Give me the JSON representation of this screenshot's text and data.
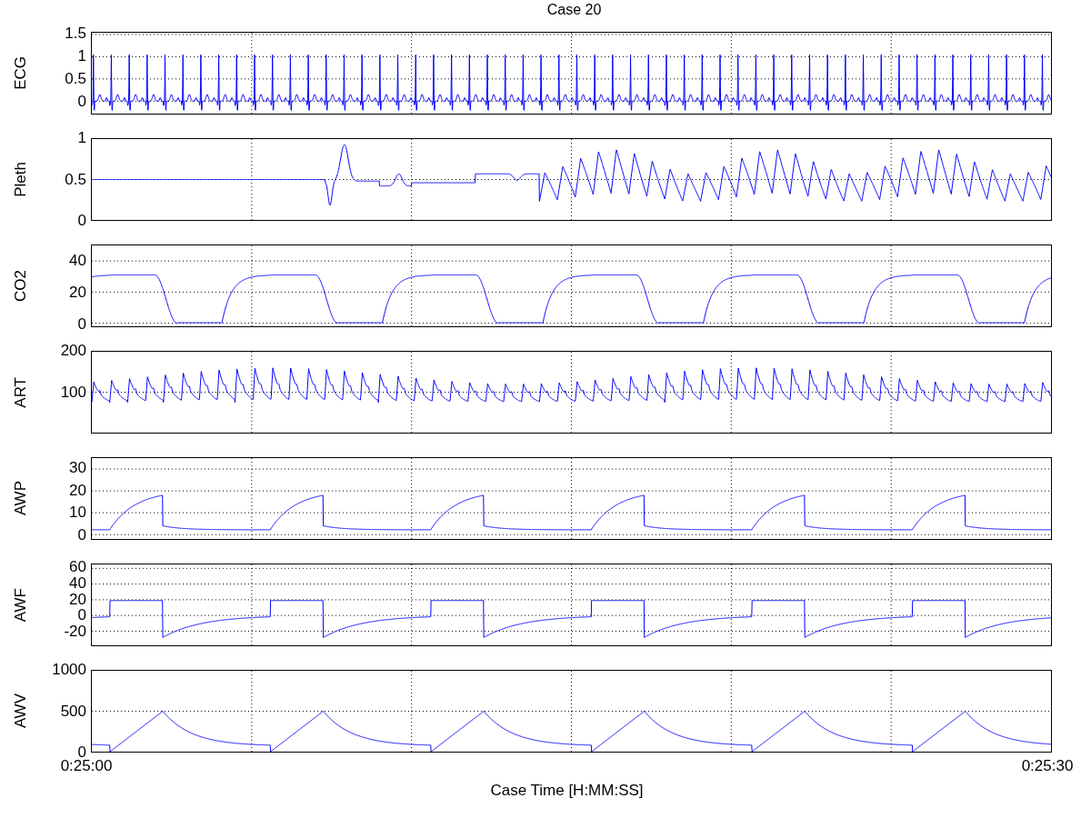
{
  "figure": {
    "title": "Case 20"
  },
  "panels": [
    {
      "kind": "ecg",
      "ylabel": "ECG",
      "yticks": [
        "1.5",
        "1",
        "0.5",
        "0"
      ]
    },
    {
      "kind": "pleth",
      "ylabel": "Pleth",
      "yticks": [
        "1",
        "0.5",
        "0"
      ]
    },
    {
      "kind": "co2",
      "ylabel": "CO2",
      "yticks": [
        "40",
        "20",
        "0"
      ]
    },
    {
      "kind": "art",
      "ylabel": "ART",
      "yticks": [
        "200",
        "100"
      ]
    },
    {
      "kind": "awp",
      "ylabel": "AWP",
      "yticks": [
        "30",
        "20",
        "10",
        "0"
      ]
    },
    {
      "kind": "awf",
      "ylabel": "AWF",
      "yticks": [
        "60",
        "40",
        "20",
        "0",
        "-20"
      ]
    },
    {
      "kind": "awv",
      "ylabel": "AWV",
      "yticks": [
        "1000",
        "500",
        "0"
      ]
    }
  ],
  "x_axis": {
    "ticks": [
      "0:25:00",
      "0:25:30"
    ],
    "label": "Case Time [H:MM:SS]"
  }
}
